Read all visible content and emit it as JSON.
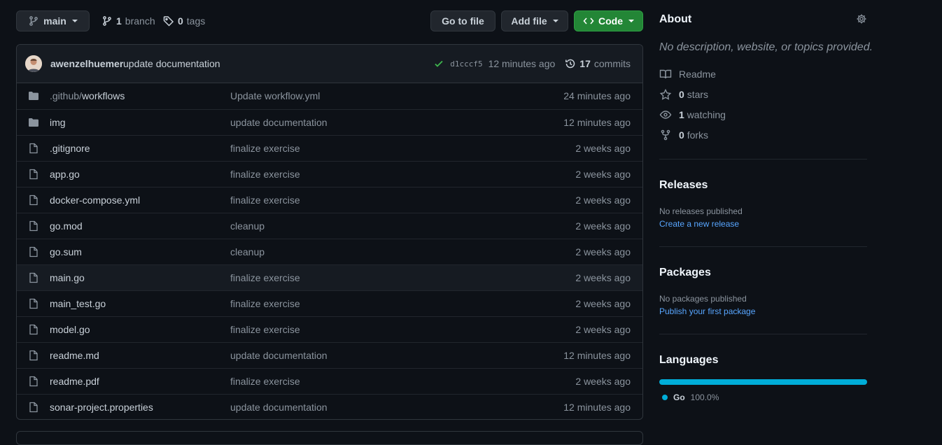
{
  "toolbar": {
    "branch_label": "main",
    "branch_count": "1",
    "branch_word": "branch",
    "tags_count": "0",
    "tags_word": "tags",
    "goto_file_label": "Go to file",
    "add_file_label": "Add file",
    "code_label": "Code"
  },
  "commit": {
    "author": "awenzelhuemer",
    "message": "update documentation",
    "sha": "d1cccf5",
    "time": "12 minutes ago",
    "commits_count": "17",
    "commits_word": "commits"
  },
  "files": [
    {
      "type": "folder",
      "name_dim": ".github/",
      "name": "workflows",
      "message": "Update workflow.yml",
      "age": "24 minutes ago"
    },
    {
      "type": "folder",
      "name_dim": "",
      "name": "img",
      "message": "update documentation",
      "age": "12 minutes ago"
    },
    {
      "type": "file",
      "name_dim": "",
      "name": ".gitignore",
      "message": "finalize exercise",
      "age": "2 weeks ago"
    },
    {
      "type": "file",
      "name_dim": "",
      "name": "app.go",
      "message": "finalize exercise",
      "age": "2 weeks ago"
    },
    {
      "type": "file",
      "name_dim": "",
      "name": "docker-compose.yml",
      "message": "finalize exercise",
      "age": "2 weeks ago"
    },
    {
      "type": "file",
      "name_dim": "",
      "name": "go.mod",
      "message": "cleanup",
      "age": "2 weeks ago"
    },
    {
      "type": "file",
      "name_dim": "",
      "name": "go.sum",
      "message": "cleanup",
      "age": "2 weeks ago"
    },
    {
      "type": "file",
      "name_dim": "",
      "name": "main.go",
      "message": "finalize exercise",
      "age": "2 weeks ago"
    },
    {
      "type": "file",
      "name_dim": "",
      "name": "main_test.go",
      "message": "finalize exercise",
      "age": "2 weeks ago"
    },
    {
      "type": "file",
      "name_dim": "",
      "name": "model.go",
      "message": "finalize exercise",
      "age": "2 weeks ago"
    },
    {
      "type": "file",
      "name_dim": "",
      "name": "readme.md",
      "message": "update documentation",
      "age": "12 minutes ago"
    },
    {
      "type": "file",
      "name_dim": "",
      "name": "readme.pdf",
      "message": "finalize exercise",
      "age": "2 weeks ago"
    },
    {
      "type": "file",
      "name_dim": "",
      "name": "sonar-project.properties",
      "message": "update documentation",
      "age": "12 minutes ago"
    }
  ],
  "about": {
    "title": "About",
    "description": "No description, website, or topics provided.",
    "readme": "Readme",
    "stars_count": "0",
    "stars_word": "stars",
    "watching_count": "1",
    "watching_word": "watching",
    "forks_count": "0",
    "forks_word": "forks"
  },
  "releases": {
    "title": "Releases",
    "empty": "No releases published",
    "link": "Create a new release"
  },
  "packages": {
    "title": "Packages",
    "empty": "No packages published",
    "link": "Publish your first package"
  },
  "languages": {
    "title": "Languages",
    "name": "Go",
    "percent": "100.0%",
    "color": "#00add8"
  },
  "colors": {
    "background": "#0d1117",
    "primary_button": "#238636",
    "link": "#58a6ff"
  }
}
